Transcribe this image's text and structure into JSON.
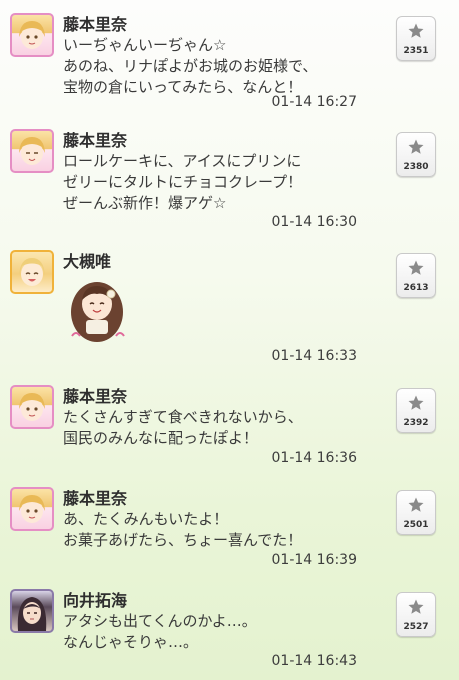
{
  "messages": [
    {
      "sender": "藤本里奈",
      "text": "いーぢゃんいーぢゃん☆\nあのね、リナぽよがお城のお姫様で、\n宝物の倉にいってみたら、なんと！",
      "time": "01-14 16:27",
      "stars": "2351",
      "avatar": "rina-avatar"
    },
    {
      "sender": "藤本里奈",
      "text": "ロールケーキに、アイスにプリンに\nゼリーにタルトにチョコクレープ！\nぜーんぶ新作！爆アゲ☆",
      "time": "01-14 16:30",
      "stars": "2380",
      "avatar": "rina-avatar"
    },
    {
      "sender": "大槻唯",
      "text": "",
      "time": "01-14 16:33",
      "stars": "2613",
      "avatar": "yui-avatar",
      "stamp": "yui-stamp-image"
    },
    {
      "sender": "藤本里奈",
      "text": "たくさんすぎて食べきれないから、\n国民のみんなに配ったぽよ！",
      "time": "01-14 16:36",
      "stars": "2392",
      "avatar": "rina-avatar"
    },
    {
      "sender": "藤本里奈",
      "text": "あ、たくみんもいたよ！\nお菓子あげたら、ちょー喜んでた！",
      "time": "01-14 16:39",
      "stars": "2501",
      "avatar": "rina-avatar"
    },
    {
      "sender": "向井拓海",
      "text": "アタシも出てくんのかよ…。\nなんじゃそりゃ…。",
      "time": "01-14 16:43",
      "stars": "2527",
      "avatar": "takumi-avatar"
    }
  ],
  "icons": {
    "star": "star-icon"
  },
  "colors": {
    "star": "#8a8a8a",
    "rina_frame": "#e58ec4",
    "yui_frame": "#f0b23a"
  }
}
